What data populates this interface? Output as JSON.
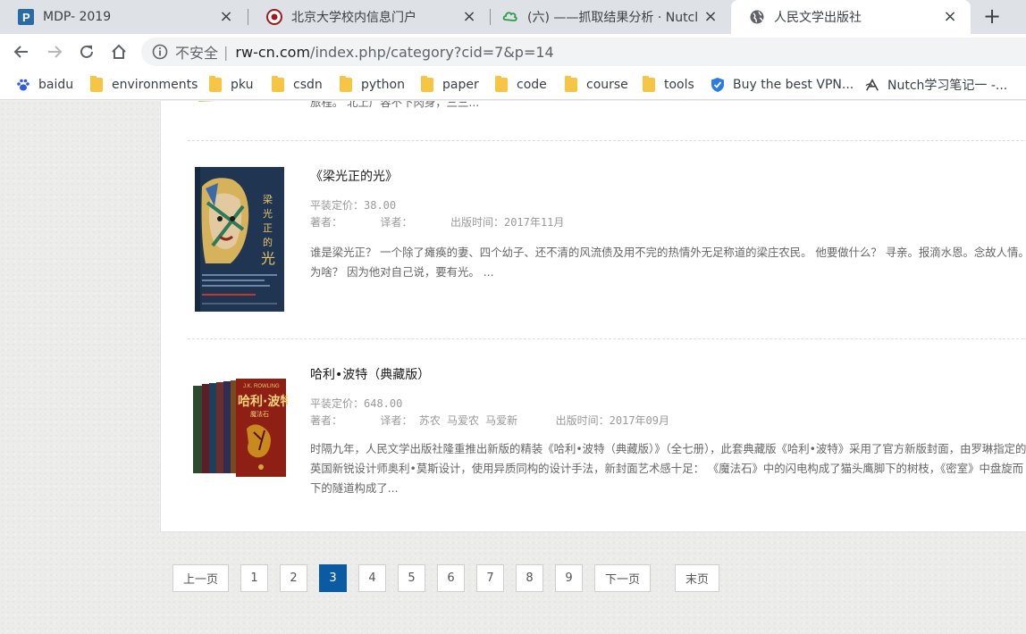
{
  "browser": {
    "tabs": [
      {
        "title": "MDP- 2019",
        "icon": "pomodoro-p-icon"
      },
      {
        "title": "北京大学校内信息门户",
        "icon": "pku-seal-icon"
      },
      {
        "title": "(六) ——抓取结果分析 · Nutcl",
        "icon": "green-cloud-icon"
      },
      {
        "title": "人民文学出版社",
        "icon": "globe-icon"
      }
    ],
    "new_tab_label": "+",
    "close_label": "×",
    "address": {
      "insecure_label": "不安全",
      "separator": "|",
      "host": "rw-cn.com",
      "path": "/index.php/category?cid=7&p=14"
    },
    "bookmarks": [
      {
        "label": "baidu",
        "icon": "baidu-paw-icon"
      },
      {
        "label": "environments",
        "icon": "folder-icon"
      },
      {
        "label": "pku",
        "icon": "folder-icon"
      },
      {
        "label": "csdn",
        "icon": "folder-icon"
      },
      {
        "label": "python",
        "icon": "folder-icon"
      },
      {
        "label": "paper",
        "icon": "folder-icon"
      },
      {
        "label": "code",
        "icon": "folder-icon"
      },
      {
        "label": "course",
        "icon": "folder-icon"
      },
      {
        "label": "tools",
        "icon": "folder-icon"
      },
      {
        "label": "Buy the best VPN...",
        "icon": "shield-icon"
      },
      {
        "label": "Nutch学习笔记一 -...",
        "icon": "a-logo-icon"
      }
    ]
  },
  "page": {
    "truncated_text": "旅程。 北上广容不下肉身，三三...",
    "books": [
      {
        "title": "《梁光正的光》",
        "price": "平装定价：38.00",
        "author_label": "著者：",
        "translator_label": "译者：",
        "translator": "",
        "date": "出版时间：2017年11月",
        "description": "谁是梁光正？ 一个除了瘫痪的妻、四个幼子、还不清的风流债及用不完的热情外无足称道的梁庄农民。 他要做什么？ 寻亲。报滴水恩。念故人情。 为啥？ 因为他对自己说，要有光。 ..."
      },
      {
        "title": "哈利•波特（典藏版）",
        "price": "平装定价：648.00",
        "author_label": "著者：",
        "translator_label": "译者：",
        "translator": "苏农 马爱农 马爱新",
        "date": "出版时间：2017年09月",
        "description": "时隔九年，人民文学出版社隆重推出新版的精装《哈利•波特（典藏版）》（全七册），此套典藏版《哈利•波特》采用了官方新版封面，由罗琳指定的英国新锐设计师奥利•莫斯设计，使用异质同构的设计手法，新封面艺术感十足： 《魔法石》中的闪电构成了猫头鹰脚下的树枝，《密室》中盘旋而下的隧道构成了..."
      }
    ],
    "pagination": {
      "prev": "上一页",
      "pages": [
        "1",
        "2",
        "3",
        "4",
        "5",
        "6",
        "7",
        "8",
        "9"
      ],
      "current": "3",
      "next": "下一页",
      "last": "末页"
    }
  }
}
